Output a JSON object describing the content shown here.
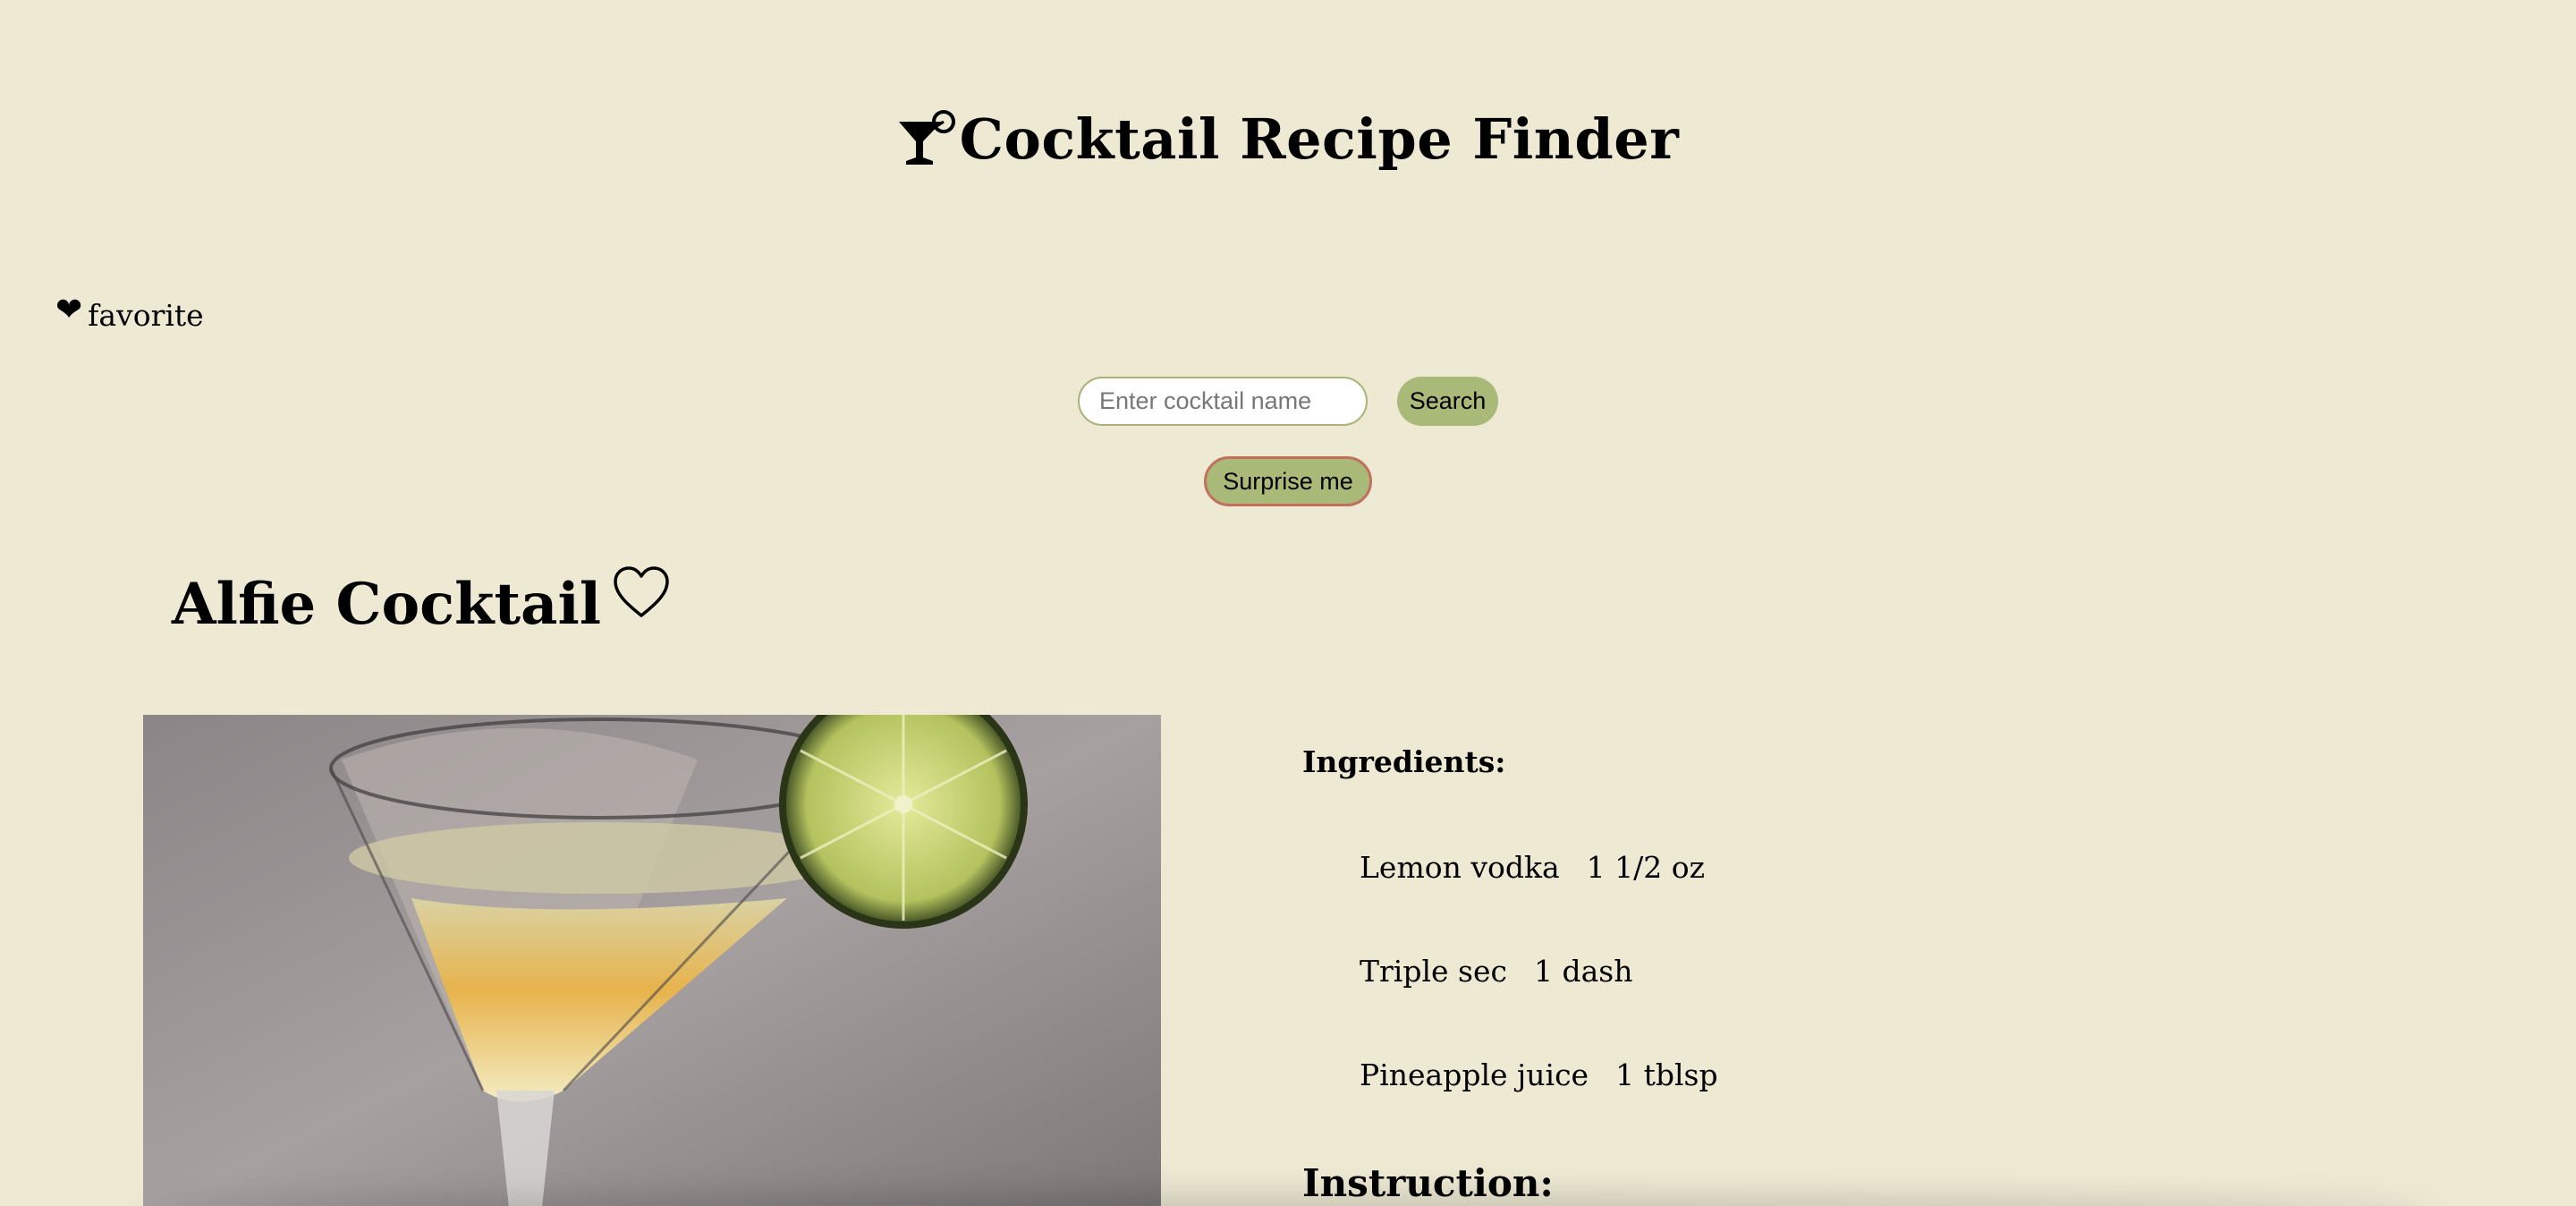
{
  "header": {
    "logo_icon": "cocktail-glass-icon",
    "title": "Cocktail Recipe Finder"
  },
  "favorite_link": {
    "icon": "heart-filled-icon",
    "label": "favorite"
  },
  "search": {
    "placeholder": "Enter cocktail name",
    "value": "",
    "button_label": "Search"
  },
  "surprise": {
    "button_label": "Surprise me"
  },
  "cocktail": {
    "name": "Alfie Cocktail",
    "favorite_icon": "heart-outline-icon",
    "ingredients_heading": "Ingredients:",
    "ingredients": [
      {
        "name": "Lemon vodka",
        "measure": "1 1/2 oz"
      },
      {
        "name": "Triple sec",
        "measure": "1 dash"
      },
      {
        "name": "Pineapple juice",
        "measure": "1 tblsp"
      }
    ],
    "instruction_heading": "Instruction:"
  },
  "colors": {
    "background": "#ede9d3",
    "accent_button": "#a9b977",
    "input_border": "#a7b477",
    "surprise_border": "#c0705d"
  }
}
